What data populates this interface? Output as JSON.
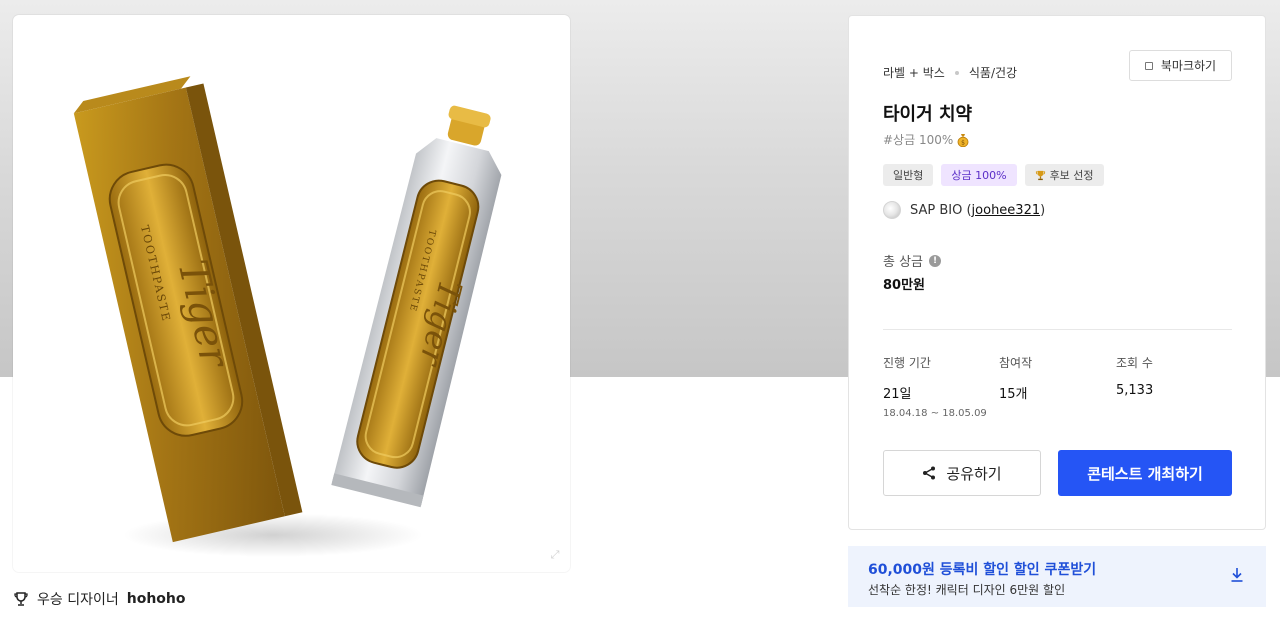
{
  "winner": {
    "label": "우승 디자이너",
    "name": "hohoho"
  },
  "product_image": {
    "box_text_small": "TOOTHPASTE",
    "box_text_large": "Tiger"
  },
  "panel": {
    "category_1": "라벨 + 박스",
    "category_2": "식품/건강",
    "bookmark_label": "북마크하기",
    "title": "타이거 치약",
    "prize_tag": "#상금 100%",
    "chips": {
      "type": "일반형",
      "prize": "상금 100%",
      "candidate": "후보 선정"
    },
    "host": {
      "company": "SAP BIO (",
      "username": "joohee321",
      "close": ")"
    },
    "total_prize_label": "총 상금",
    "total_prize_value": "80만원",
    "stats": {
      "period_label": "진행 기간",
      "period_value": "21일",
      "period_dates": "18.04.18 ~ 18.05.09",
      "entries_label": "참여작",
      "entries_value": "15개",
      "views_label": "조회 수",
      "views_value": "5,133"
    },
    "share_label": "공유하기",
    "host_contest_label": "콘테스트 개최하기"
  },
  "coupon": {
    "title": "60,000원 등록비 할인 할인 쿠폰받기",
    "subtitle": "선착순 한정! 캐릭터 디자인 6만원 할인"
  },
  "colors": {
    "primary": "#2555f5",
    "coupon_bg": "#eef3fd",
    "chip_purple": "#efe4ff"
  }
}
